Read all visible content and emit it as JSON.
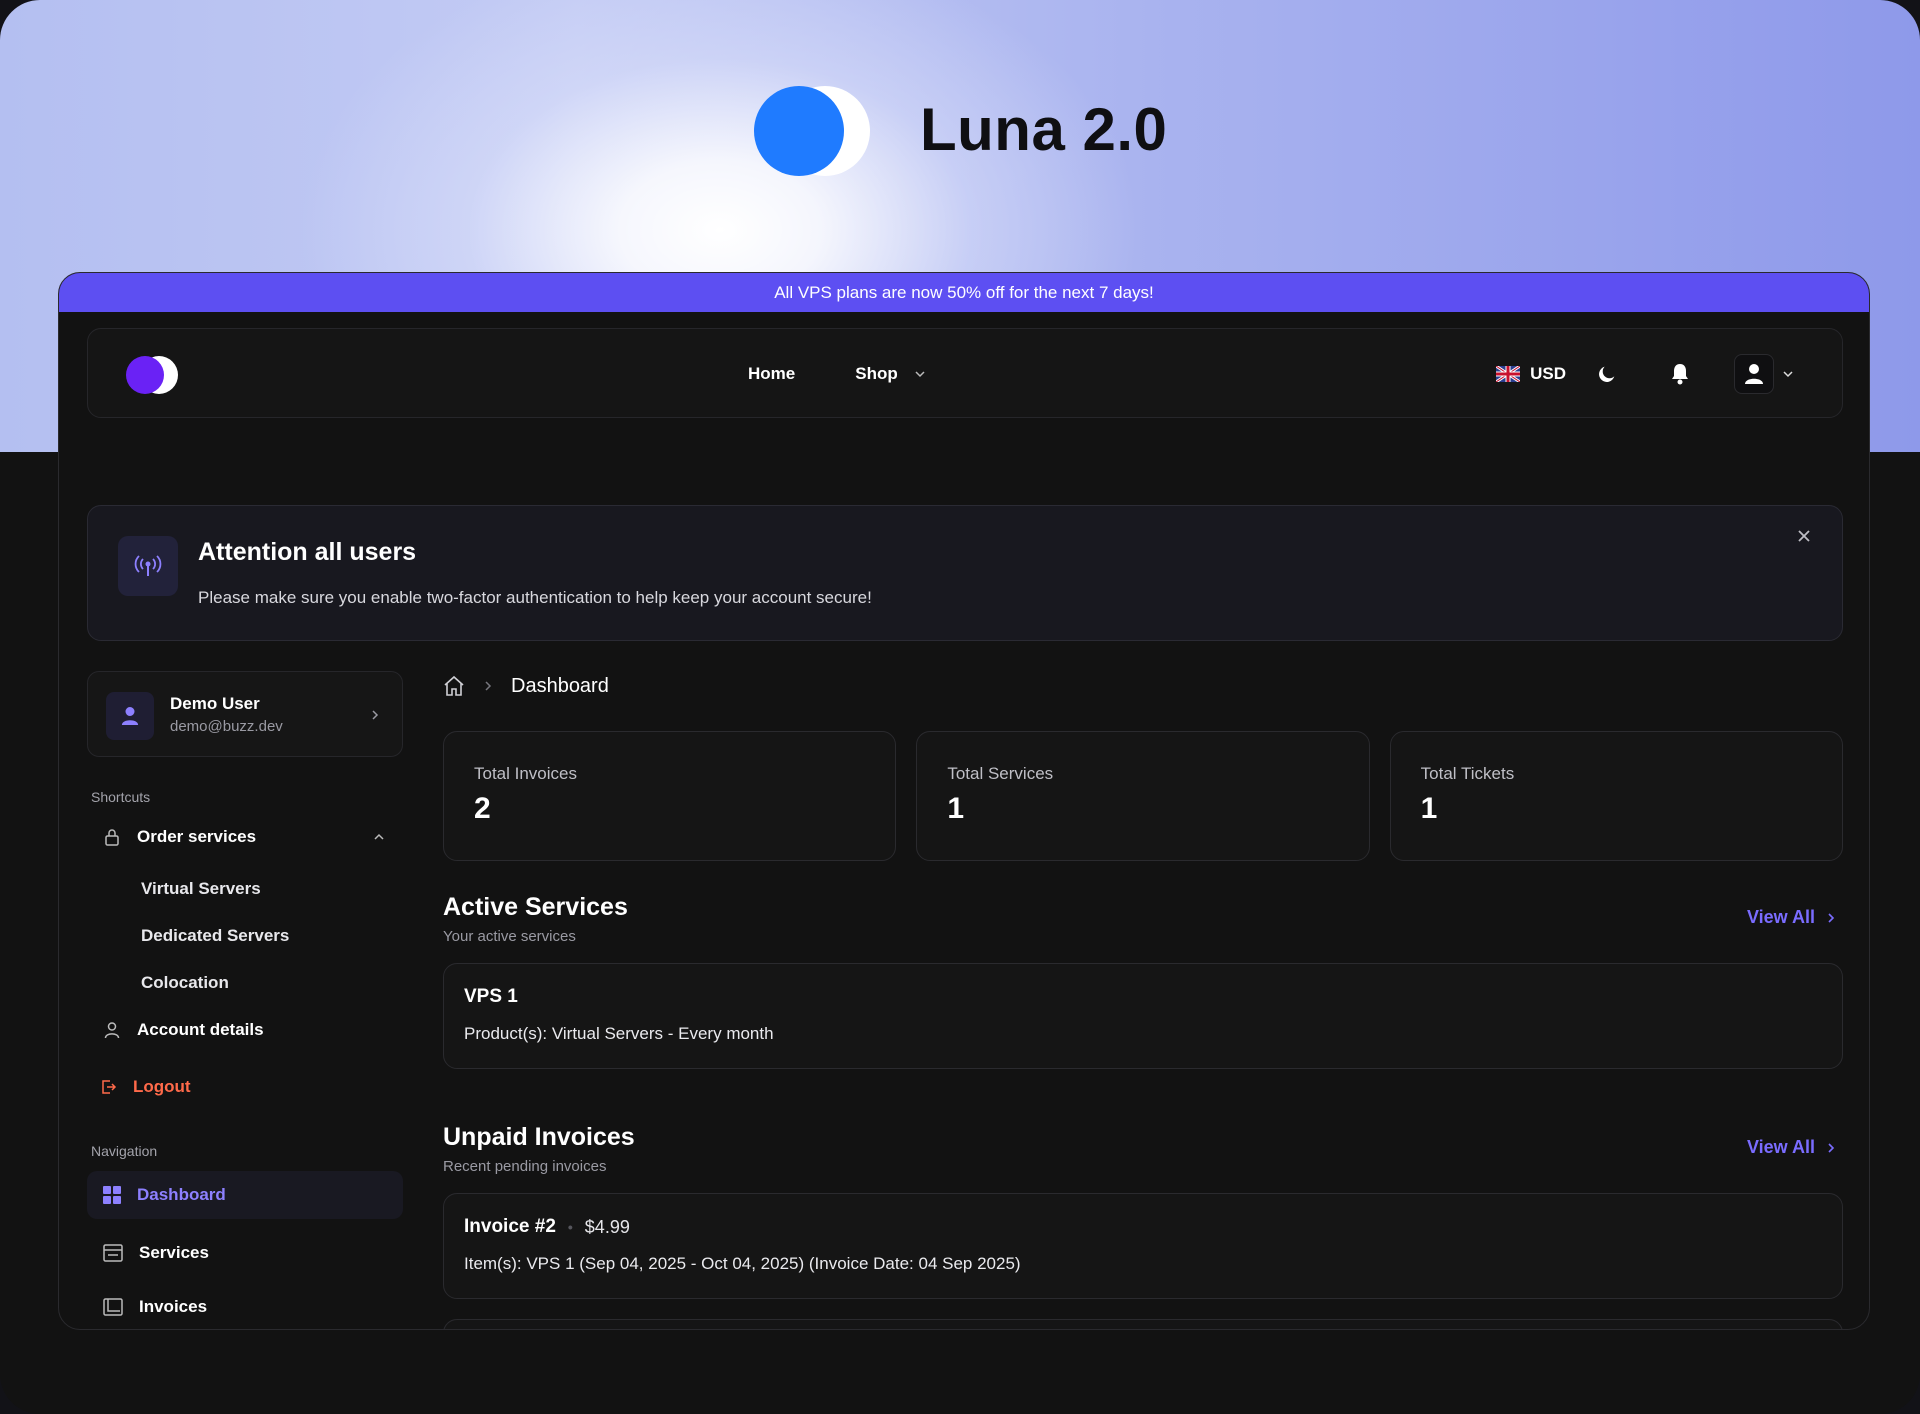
{
  "hero": {
    "title": "Luna 2.0"
  },
  "promo": {
    "text": "All VPS plans are now 50% off for the next 7 days!"
  },
  "navbar": {
    "links": [
      {
        "label": "Home"
      },
      {
        "label": "Shop"
      }
    ],
    "currency": "USD"
  },
  "alert": {
    "title": "Attention all users",
    "message": "Please make sure you enable two-factor authentication to help keep your account secure!"
  },
  "user": {
    "name": "Demo User",
    "email": "demo@buzz.dev"
  },
  "sidebar": {
    "shortcuts_label": "Shortcuts",
    "order_services": {
      "label": "Order services",
      "children": [
        "Virtual Servers",
        "Dedicated Servers",
        "Colocation"
      ]
    },
    "account_details": "Account details",
    "logout": "Logout",
    "navigation_label": "Navigation",
    "nav": [
      "Dashboard",
      "Services",
      "Invoices"
    ]
  },
  "breadcrumb": {
    "current": "Dashboard"
  },
  "stats": [
    {
      "label": "Total Invoices",
      "value": "2"
    },
    {
      "label": "Total Services",
      "value": "1"
    },
    {
      "label": "Total Tickets",
      "value": "1"
    }
  ],
  "active_services": {
    "title": "Active Services",
    "subtitle": "Your active services",
    "view_all": "View All",
    "items": [
      {
        "name": "VPS 1",
        "detail": "Product(s): Virtual Servers - Every month"
      }
    ]
  },
  "unpaid_invoices": {
    "title": "Unpaid Invoices",
    "subtitle": "Recent pending invoices",
    "view_all": "View All",
    "items": [
      {
        "name": "Invoice #2",
        "amount": "$4.99",
        "detail": "Item(s): VPS 1 (Sep 04, 2025 - Oct 04, 2025) (Invoice Date: 04 Sep 2025)"
      }
    ]
  },
  "colors": {
    "accent": "#5d4ff2",
    "link": "#7a6cff",
    "logout": "#ff6a4a",
    "hero_logo": "#1f7bff",
    "nav_logo": "#6a22f5"
  }
}
